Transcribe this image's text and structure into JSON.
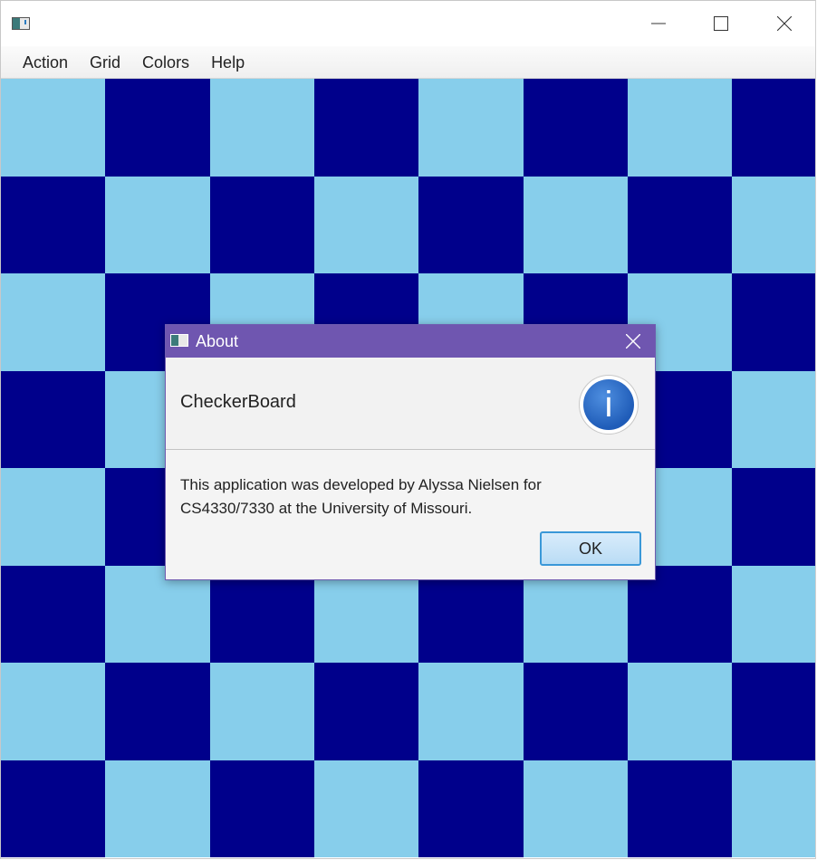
{
  "window": {
    "app_icon": "app-window-icon",
    "controls": {
      "minimize_icon": "minimize-icon",
      "maximize_icon": "maximize-icon",
      "close_icon": "close-icon"
    }
  },
  "menubar": {
    "items": [
      {
        "label": "Action"
      },
      {
        "label": "Grid"
      },
      {
        "label": "Colors"
      },
      {
        "label": "Help"
      }
    ]
  },
  "board": {
    "rows": 8,
    "columns": 8,
    "light_color": "#87CEEB",
    "dark_color": "#00008B"
  },
  "dialog": {
    "title": "About",
    "header": "CheckerBoard",
    "icon": "info-icon",
    "message_line1": "This application was developed by Alyssa Nielsen for",
    "message_line2": "CS4330/7330 at the University of Missouri.",
    "ok_label": "OK",
    "accent_color": "#6F56B0"
  }
}
